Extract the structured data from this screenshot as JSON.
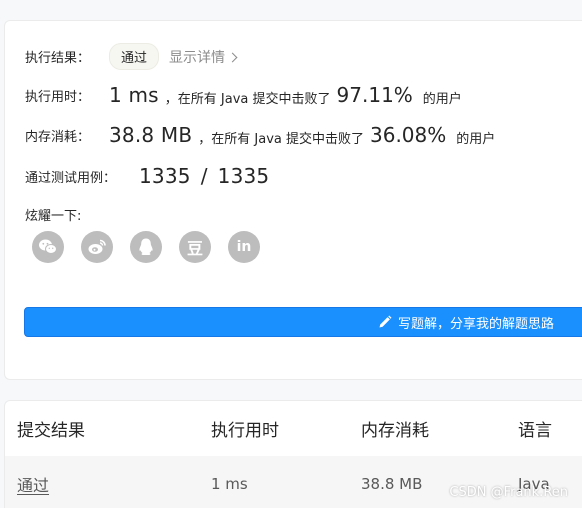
{
  "result": {
    "label": "执行结果：",
    "status": "通过",
    "detail_link": "显示详情"
  },
  "runtime": {
    "label": "执行用时：",
    "value": "1 ms",
    "mid_text": "，在所有 Java 提交中击败了",
    "percent": "97.11%",
    "suffix": "的用户"
  },
  "memory": {
    "label": "内存消耗：",
    "value": "38.8 MB",
    "mid_text": "，在所有 Java 提交中击败了",
    "percent": "36.08%",
    "suffix": "的用户"
  },
  "tests": {
    "label": "通过测试用例：",
    "passed": "1335",
    "separator": "/",
    "total": "1335"
  },
  "share": {
    "label": "炫耀一下:",
    "icons": [
      "wechat-icon",
      "weibo-icon",
      "qq-icon",
      "douban-icon",
      "linkedin-icon"
    ],
    "douban_glyph": "豆",
    "linkedin_glyph": "in"
  },
  "write_button": {
    "label": "写题解，分享我的解题思路",
    "icon": "pencil-icon"
  },
  "table": {
    "headers": [
      "提交结果",
      "执行用时",
      "内存消耗",
      "语言"
    ],
    "rows": [
      {
        "result": "通过",
        "time": "1 ms",
        "memory": "38.8 MB",
        "language": "Java"
      }
    ]
  },
  "watermark": "CSDN @Frank.Ren",
  "colors": {
    "accent_blue": "#1a90ff",
    "pass_green": "#2db55d",
    "icon_gray": "#bdbdbd"
  }
}
